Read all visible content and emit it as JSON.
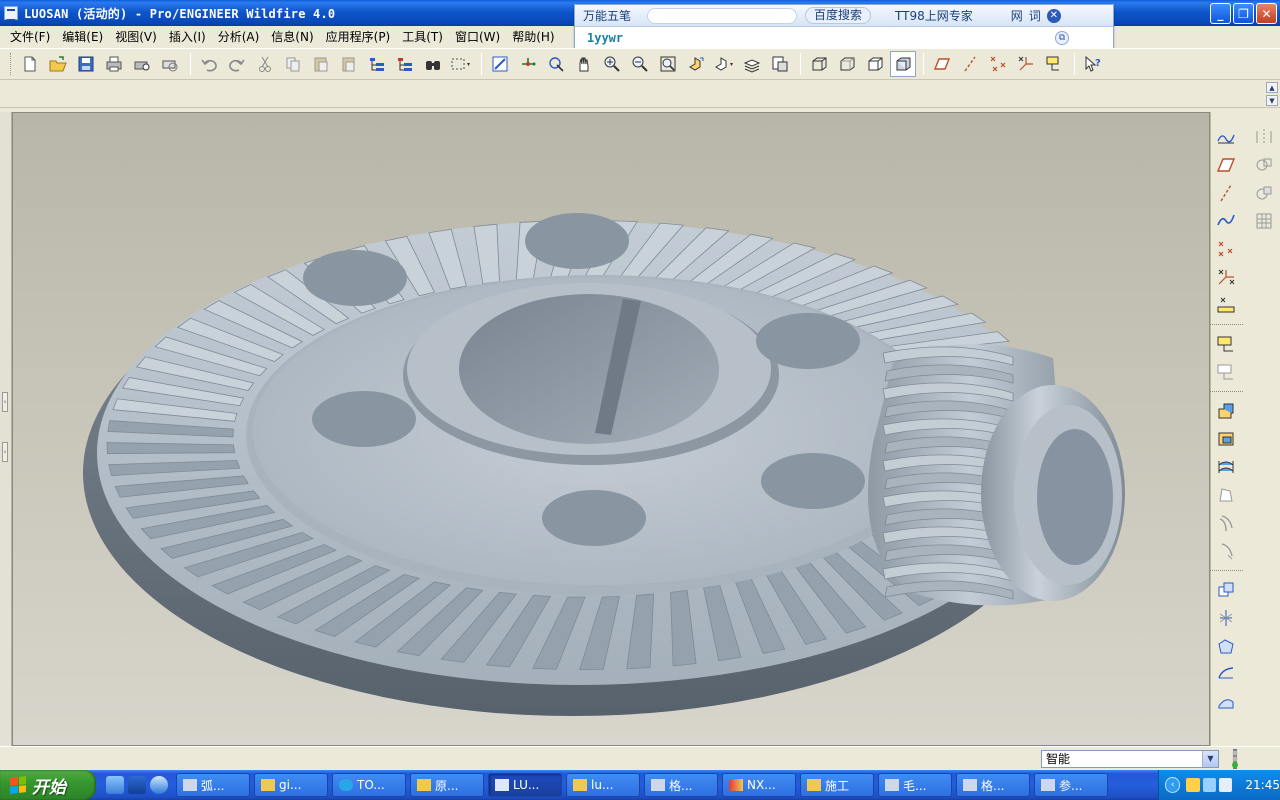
{
  "window": {
    "title": "LUOSAN (活动的) - Pro/ENGINEER Wildfire 4.0",
    "minimize": "_",
    "maximize": "❐",
    "close": "✕"
  },
  "ime": {
    "name": "万能五笔",
    "search_label": "百度搜索",
    "expert_label": "TT98上网专家",
    "btn_web": "网",
    "btn_word": "词",
    "close": "✕",
    "input_text": "1yywr",
    "settings_icon": "⧉"
  },
  "menu": [
    {
      "label": "文件(F)"
    },
    {
      "label": "编辑(E)"
    },
    {
      "label": "视图(V)"
    },
    {
      "label": "插入(I)"
    },
    {
      "label": "分析(A)"
    },
    {
      "label": "信息(N)"
    },
    {
      "label": "应用程序(P)"
    },
    {
      "label": "工具(T)"
    },
    {
      "label": "窗口(W)"
    },
    {
      "label": "帮助(H)"
    }
  ],
  "toolbar_icons": [
    "new-file-icon",
    "open-folder-icon",
    "save-icon",
    "print-icon",
    "print-preview-icon",
    "email-icon",
    "undo-icon",
    "redo-icon",
    "cut-icon",
    "copy-icon",
    "paste-icon",
    "paste-special-icon",
    "regenerate-icon",
    "regenerate-manager-icon",
    "find-icon",
    "select-box-icon",
    "repaint-icon",
    "spin-center-icon",
    "orient-mode-icon",
    "pan-hand-icon",
    "zoom-in-icon",
    "zoom-out-icon",
    "refit-icon",
    "reorient-icon",
    "saved-views-icon",
    "layers-icon",
    "view-manager-icon",
    "wireframe-icon",
    "hidden-line-icon",
    "no-hidden-icon",
    "shading-icon",
    "datum-planes-icon",
    "datum-axes-icon",
    "datum-points-icon",
    "coord-systems-icon",
    "annotations-icon",
    "context-help-icon"
  ],
  "right_toolbar_icons": {
    "col1": [
      "sketched-curve-icon",
      "datum-plane-icon",
      "datum-axis-icon",
      "datum-curve-icon",
      "datum-point-icon",
      "csys-icon",
      "analysis-feature-icon",
      "annotation-feature-icon",
      "annotation-note-icon",
      "extrude-icon",
      "revolve-icon",
      "variable-sweep-icon",
      "blend-icon",
      "hole-icon",
      "round-icon",
      "shell-icon",
      "draft-icon",
      "rib-icon",
      "boundary-blend-icon",
      "style-icon"
    ],
    "col2": [
      "mirror-icon",
      "merge-icon",
      "trim-icon",
      "pattern-icon"
    ]
  },
  "status": {
    "filter_value": "智能",
    "filter_arrow": "▼"
  },
  "taskbar": {
    "start_label": "开始",
    "tasks": [
      {
        "label": "弧..."
      },
      {
        "label": "gi..."
      },
      {
        "label": "TO..."
      },
      {
        "label": "原..."
      },
      {
        "label": "LU...",
        "active": true
      },
      {
        "label": "lu..."
      },
      {
        "label": "格..."
      },
      {
        "label": "NX..."
      },
      {
        "label": "施工"
      },
      {
        "label": "毛..."
      },
      {
        "label": "格..."
      },
      {
        "label": "参..."
      }
    ],
    "tray_chevron": "‹",
    "clock": "21:45"
  },
  "colors": {
    "gear_light": "#b7c1cb",
    "gear_mid": "#9aa6b2",
    "gear_dark": "#6b7682",
    "viewport_bg": "#c7c5b8",
    "title_blue": "#0f56c9"
  }
}
